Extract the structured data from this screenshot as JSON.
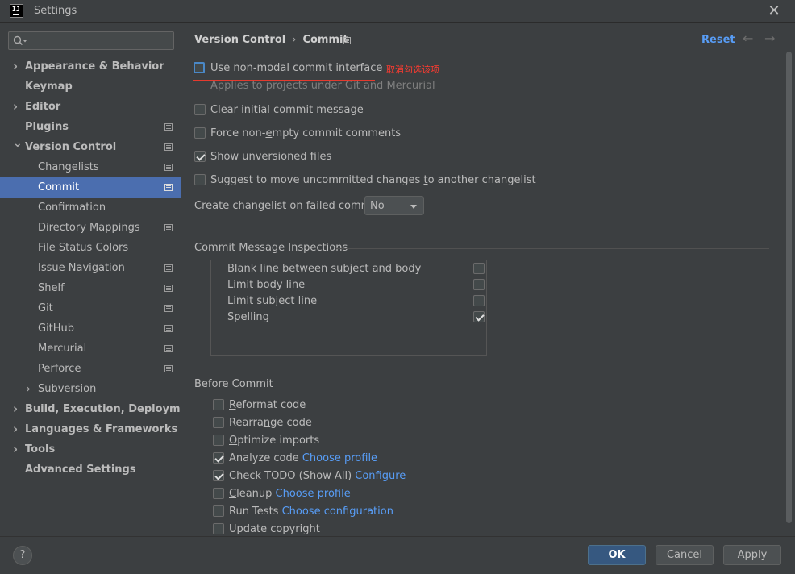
{
  "window": {
    "title": "Settings",
    "app_icon_text": "IJ",
    "close_glyph": "✕"
  },
  "sidebar": {
    "search_placeholder": "",
    "items": [
      {
        "label": "Appearance & Behavior",
        "level": 0,
        "expandable": true,
        "expanded": false
      },
      {
        "label": "Keymap",
        "level": 0,
        "expandable": false
      },
      {
        "label": "Editor",
        "level": 0,
        "expandable": true,
        "expanded": false
      },
      {
        "label": "Plugins",
        "level": 0,
        "expandable": false
      },
      {
        "label": "Version Control",
        "level": 0,
        "expandable": true,
        "expanded": true
      },
      {
        "label": "Changelists",
        "level": 1
      },
      {
        "label": "Commit",
        "level": 1,
        "selected": true
      },
      {
        "label": "Confirmation",
        "level": 1
      },
      {
        "label": "Directory Mappings",
        "level": 1
      },
      {
        "label": "File Status Colors",
        "level": 1
      },
      {
        "label": "Issue Navigation",
        "level": 1
      },
      {
        "label": "Shelf",
        "level": 1
      },
      {
        "label": "Git",
        "level": 1
      },
      {
        "label": "GitHub",
        "level": 1
      },
      {
        "label": "Mercurial",
        "level": 1
      },
      {
        "label": "Perforce",
        "level": 1
      },
      {
        "label": "Subversion",
        "level": 1,
        "expandable": true,
        "expanded": false
      },
      {
        "label": "Build, Execution, Deployment",
        "level": 0,
        "expandable": true,
        "expanded": false
      },
      {
        "label": "Languages & Frameworks",
        "level": 0,
        "expandable": true,
        "expanded": false
      },
      {
        "label": "Tools",
        "level": 0,
        "expandable": true,
        "expanded": false
      },
      {
        "label": "Advanced Settings",
        "level": 0,
        "expandable": false
      }
    ]
  },
  "header": {
    "breadcrumb_parent": "Version Control",
    "breadcrumb_sep": "›",
    "breadcrumb_current": "Commit",
    "reset_label": "Reset",
    "back_glyph": "←",
    "forward_glyph": "→"
  },
  "options": {
    "non_modal": {
      "label": "Use non-modal commit interface",
      "checked": false
    },
    "non_modal_hint": "Applies to projects under Git and Mercurial",
    "annotation": "取消勾选该项",
    "clear_initial": {
      "pre": "Clear ",
      "u": "i",
      "post": "nitial commit message",
      "checked": false
    },
    "force_non_empty": {
      "pre": "Force non-",
      "u": "e",
      "post": "mpty commit comments",
      "checked": false
    },
    "show_unversioned": {
      "label": "Show unversioned files",
      "checked": true
    },
    "suggest_move": {
      "pre": "Suggest to move uncommitted changes ",
      "u": "t",
      "post": "o another changelist",
      "checked": false
    },
    "create_changelist_label": "Create changelist on failed commit:",
    "create_changelist_value": "No"
  },
  "inspections": {
    "title": "Commit Message Inspections",
    "items": [
      {
        "label": "Blank line between subject and body",
        "checked": false
      },
      {
        "label": "Limit body line",
        "checked": false
      },
      {
        "label": "Limit subject line",
        "checked": false
      },
      {
        "label": "Spelling",
        "checked": true
      }
    ]
  },
  "before_commit": {
    "title": "Before Commit",
    "items": [
      {
        "u": "R",
        "post": "eformat code",
        "checked": false
      },
      {
        "pre": "Rearra",
        "u": "n",
        "post": "ge code",
        "checked": false
      },
      {
        "u": "O",
        "post": "ptimize imports",
        "checked": false
      },
      {
        "label": "Analyze code",
        "link": "Choose profile",
        "checked": true
      },
      {
        "label": "Check TODO (Show All)",
        "link": "Configure",
        "checked": true
      },
      {
        "u": "C",
        "post": "leanup",
        "link": "Choose profile",
        "checked": false
      },
      {
        "label": "Run Tests",
        "link": "Choose configuration",
        "checked": false
      },
      {
        "label": "Update copyright",
        "checked": false
      }
    ]
  },
  "footer": {
    "help_label": "?",
    "ok_label": "OK",
    "cancel_label": "Cancel",
    "apply_u": "A",
    "apply_rest": "pply"
  },
  "colors": {
    "background": "#3c3f41",
    "selection": "#4b6eaf",
    "link": "#589df6",
    "primary_button": "#365880",
    "annotation": "#ff3b30"
  }
}
